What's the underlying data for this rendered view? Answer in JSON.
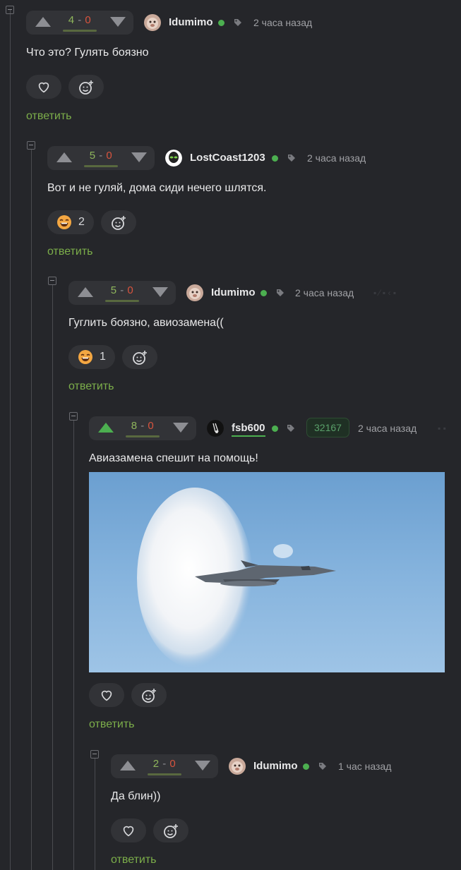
{
  "comments": [
    {
      "score_plus": "4",
      "score_minus": "0",
      "username": "Idumimo",
      "time": "2 часа назад",
      "text": "Что это? Гулять боязно",
      "reaction_count": "",
      "reply": "ответить"
    },
    {
      "score_plus": "5",
      "score_minus": "0",
      "username": "LostCoast1203",
      "time": "2 часа назад",
      "text": "Вот и не гуляй, дома сиди нечего шлятся.",
      "reaction_count": "2",
      "reply": "ответить"
    },
    {
      "score_plus": "5",
      "score_minus": "0",
      "username": "Idumimo",
      "time": "2 часа назад",
      "text": "Гуглить боязно, авиозамена((",
      "reaction_count": "1",
      "reply": "ответить"
    },
    {
      "score_plus": "8",
      "score_minus": "0",
      "username": "fsb600",
      "time": "2 часа назад",
      "badge": "32167",
      "text": "Авиазамена спешит на помощь!",
      "reaction_count": "",
      "reply": "ответить"
    },
    {
      "score_plus": "2",
      "score_minus": "0",
      "username": "Idumimo",
      "time": "1 час назад",
      "text": "Да блин))",
      "reaction_count": "",
      "reply": "ответить"
    }
  ],
  "icons": {
    "upvote": "triangle-up-icon",
    "downvote": "triangle-down-icon",
    "like": "heart-icon",
    "add_reaction": "smiley-plus-icon",
    "tag": "tag-icon"
  },
  "colors": {
    "background": "#25262a",
    "plus": "#8fb65c",
    "minus": "#d8543e",
    "online": "#4caf50",
    "reply": "#7cae4a"
  }
}
